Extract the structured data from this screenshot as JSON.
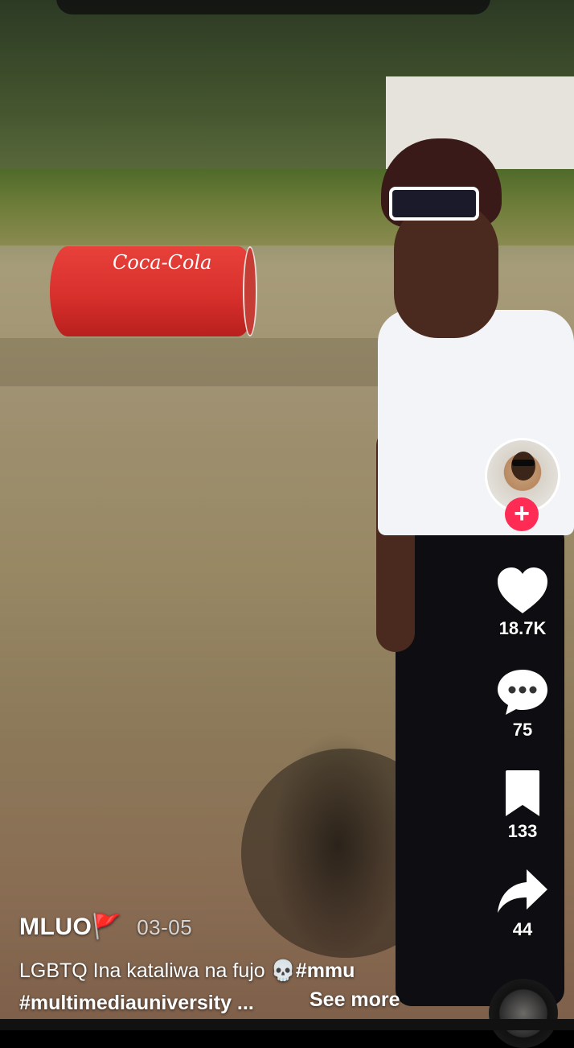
{
  "video": {
    "barrel_logo": "Coca-Cola"
  },
  "creator": {
    "username": "MLUO",
    "flag_emoji": "🚩",
    "date": "03-05",
    "follow_symbol": "+"
  },
  "actions": {
    "likes": "18.7K",
    "comments": "75",
    "saves": "133",
    "shares": "44"
  },
  "caption": {
    "line1_text": "LGBTQ Ina kataliwa na fujo 💀",
    "line1_tag": "#mmu",
    "line2": "#multimediauniversity ...",
    "see_more": "See more"
  },
  "colors": {
    "follow_accent": "#fe2c55",
    "icon_white": "#ffffff"
  },
  "icons": [
    "heart-icon",
    "comment-icon",
    "bookmark-icon",
    "share-icon",
    "music-disc-icon"
  ]
}
